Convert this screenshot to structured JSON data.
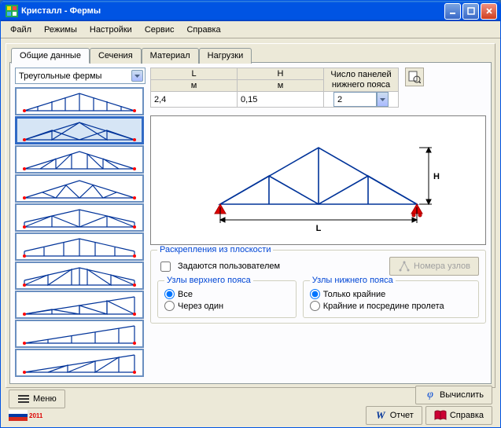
{
  "title": "Кристалл - Фермы",
  "menu": [
    "Файл",
    "Режимы",
    "Настройки",
    "Сервис",
    "Справка"
  ],
  "tabs": [
    "Общие данные",
    "Сечения",
    "Материал",
    "Нагрузки"
  ],
  "active_tab": 0,
  "truss_type_combo": "Треугольные фермы",
  "params": {
    "L": {
      "header": "L",
      "unit": "м",
      "value": "2,4"
    },
    "H": {
      "header": "H",
      "unit": "м",
      "value": "0,15"
    },
    "panels": {
      "header1": "Число панелей",
      "header2": "нижнего пояса",
      "value": "2"
    }
  },
  "group_bracing": {
    "legend": "Раскрепления из плоскости",
    "checkbox": "Задаются пользователем",
    "button": "Номера узлов"
  },
  "group_top": {
    "legend": "Узлы верхнего пояса",
    "opt1": "Все",
    "opt2": "Через один"
  },
  "group_bottom": {
    "legend": "Узлы нижнего пояса",
    "opt1": "Только крайние",
    "opt2": "Крайние и посредине пролета"
  },
  "bottom": {
    "menu": "Меню",
    "year": "2011",
    "calc": "Вычислить",
    "report": "Отчет",
    "help": "Справка"
  },
  "diagram": {
    "L": "L",
    "H": "H"
  }
}
